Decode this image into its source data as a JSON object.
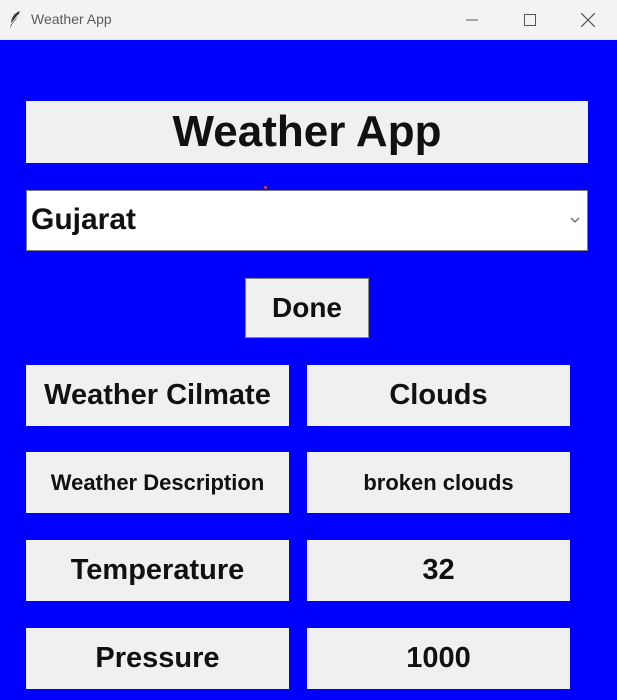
{
  "window": {
    "title": "Weather App",
    "icon": "feather-icon",
    "controls": [
      "minimize-icon",
      "maximize-icon",
      "close-icon"
    ]
  },
  "heading": "Weather App",
  "state_select": {
    "value": "Gujarat",
    "arrow_icon": "chevron-down-icon"
  },
  "done_button": {
    "label": "Done"
  },
  "rows": [
    {
      "label": "Weather Cilmate",
      "value": "Clouds"
    },
    {
      "label": "Weather Description",
      "value": "broken clouds"
    },
    {
      "label": "Temperature",
      "value": "32"
    },
    {
      "label": "Pressure",
      "value": "1000"
    }
  ],
  "colors": {
    "background": "#0000ff",
    "panel": "#f0f0f0",
    "titlebar": "#f3f3f3"
  }
}
